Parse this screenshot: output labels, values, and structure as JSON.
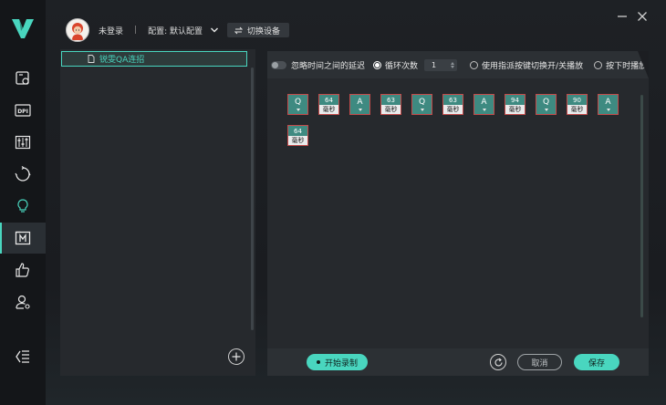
{
  "header": {
    "login_status": "未登录",
    "separator": "|",
    "config_label": "配置: 默认配置",
    "switch_device": "切换设备"
  },
  "nav": {
    "items": [
      {
        "icon": "macro-settings-icon",
        "active": false
      },
      {
        "icon": "dpi-icon",
        "label": "DPI",
        "active": false
      },
      {
        "icon": "equalizer-icon",
        "active": false
      },
      {
        "icon": "sync-icon",
        "active": false
      },
      {
        "icon": "lightbulb-icon",
        "active": false
      },
      {
        "icon": "macro-icon",
        "active": true
      },
      {
        "icon": "thumbs-up-icon",
        "active": false
      },
      {
        "icon": "user-settings-icon",
        "active": false
      }
    ],
    "collapse_icon": "collapse-menu-icon"
  },
  "macro_list": {
    "items": [
      {
        "label": "锐雯QA连招",
        "selected": true
      }
    ]
  },
  "options": {
    "ignore_delay": "忽略时间之间的延迟",
    "loop_count_label": "循环次数",
    "loop_count_value": "1",
    "toggle_mode": "使用指派按键切换开/关播放",
    "hold_mode": "按下时播放",
    "selected_mode": "loop"
  },
  "sequence": [
    {
      "type": "key",
      "key": "Q"
    },
    {
      "type": "delay",
      "value": "64",
      "unit": "毫秒"
    },
    {
      "type": "key",
      "key": "A"
    },
    {
      "type": "delay",
      "value": "63",
      "unit": "毫秒"
    },
    {
      "type": "key",
      "key": "Q"
    },
    {
      "type": "delay",
      "value": "63",
      "unit": "毫秒"
    },
    {
      "type": "key",
      "key": "A"
    },
    {
      "type": "delay",
      "value": "94",
      "unit": "毫秒"
    },
    {
      "type": "key",
      "key": "Q"
    },
    {
      "type": "delay",
      "value": "90",
      "unit": "毫秒"
    },
    {
      "type": "key",
      "key": "A"
    },
    {
      "type": "delay",
      "value": "64",
      "unit": "毫秒"
    }
  ],
  "actions": {
    "record": "开始录制",
    "cancel": "取消",
    "save": "保存"
  },
  "colors": {
    "accent": "#49d6bf",
    "key_fill": "#3e8a81",
    "key_border": "#c44a4a"
  }
}
